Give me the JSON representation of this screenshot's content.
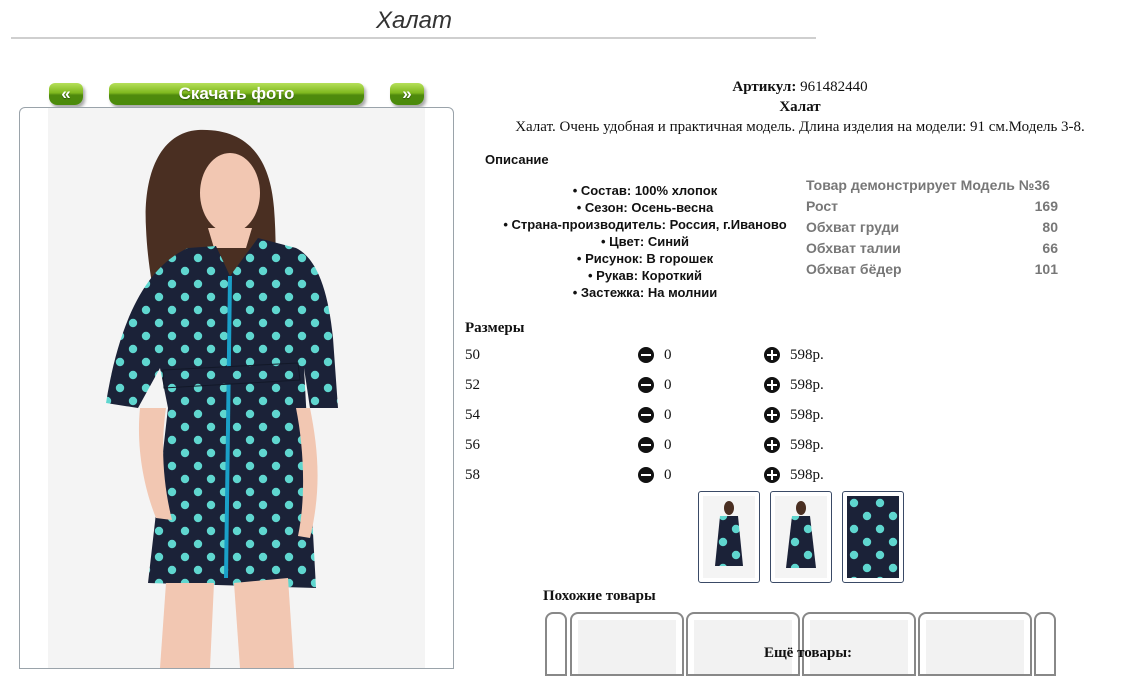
{
  "page": {
    "title": "Халат"
  },
  "gallery": {
    "prev_label": "«",
    "download_label": "Скачать фото",
    "next_label": "»"
  },
  "product": {
    "article_label": "Артикул:",
    "article_value": "961482440",
    "name": "Халат",
    "short_description": "Халат. Очень удобная и практичная модель. Длина изделия на модели: 91 см.Модель 3-8."
  },
  "description": {
    "heading": "Описание",
    "features": [
      "• Состав: 100% хлопок",
      "• Сезон: Осень-весна",
      "• Страна-производитель: Россия, г.Иваново",
      "• Цвет: Синий",
      "• Рисунок: В горошек",
      "• Рукав: Короткий",
      "• Застежка: На молнии"
    ]
  },
  "model_measurements": [
    {
      "label": "Товар демонстрирует Модель №36",
      "value": ""
    },
    {
      "label": "Рост",
      "value": "169"
    },
    {
      "label": "Обхват груди",
      "value": "80"
    },
    {
      "label": "Обхват талии",
      "value": "66"
    },
    {
      "label": "Обхват бёдер",
      "value": "101"
    }
  ],
  "sizes": {
    "heading": "Размеры",
    "rows": [
      {
        "size": "50",
        "qty": "0",
        "price": "598р."
      },
      {
        "size": "52",
        "qty": "0",
        "price": "598р."
      },
      {
        "size": "54",
        "qty": "0",
        "price": "598р."
      },
      {
        "size": "56",
        "qty": "0",
        "price": "598р."
      },
      {
        "size": "58",
        "qty": "0",
        "price": "598р."
      }
    ]
  },
  "similar": {
    "heading": "Похожие товары",
    "more_heading": "Ещё товары:"
  },
  "colors": {
    "dress_navy": "#1b2238",
    "dot_mint": "#5fd6cf",
    "zipper_teal": "#1aa0c8",
    "button_green": "#5a9a12"
  }
}
